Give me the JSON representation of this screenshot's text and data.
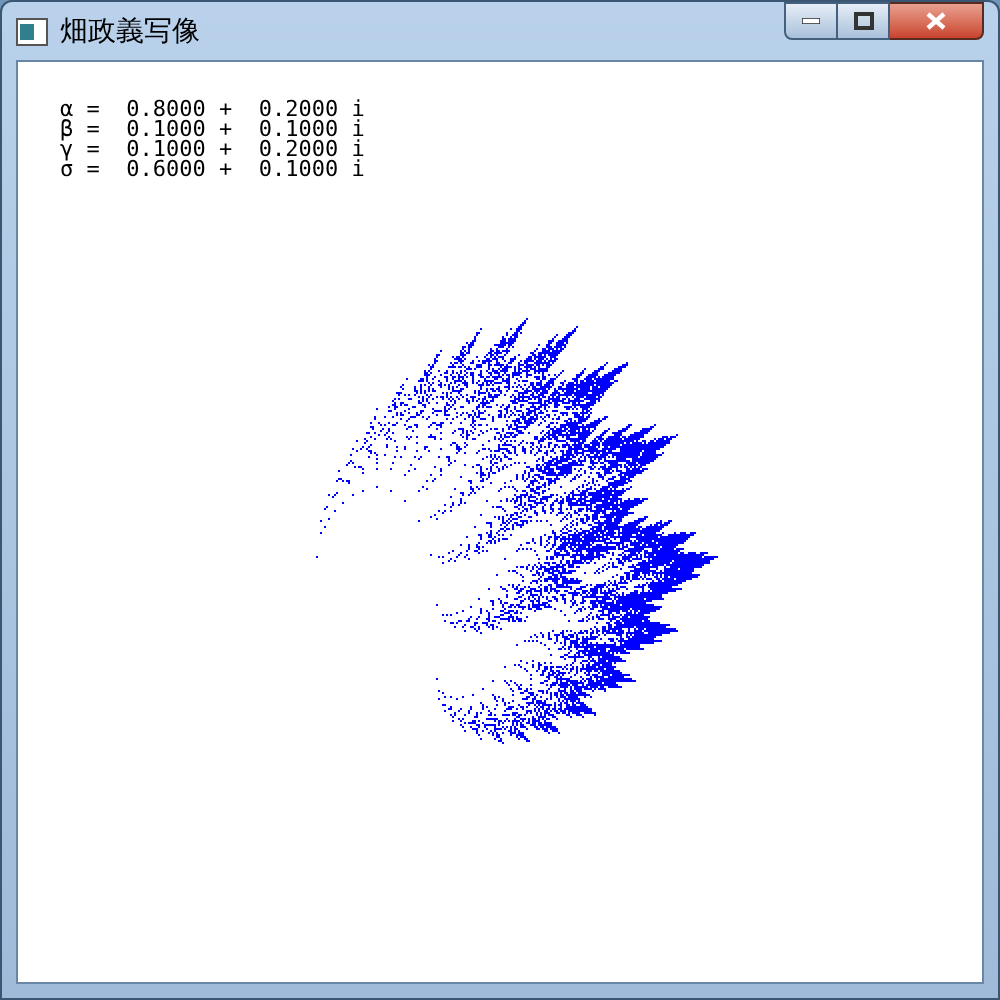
{
  "window": {
    "title": "畑政義写像"
  },
  "parameters": [
    "α =  0.8000 +  0.2000 i",
    "β =  0.1000 +  0.1000 i",
    "γ =  0.1000 +  0.2000 i",
    "σ =  0.6000 +  0.1000 i"
  ]
}
